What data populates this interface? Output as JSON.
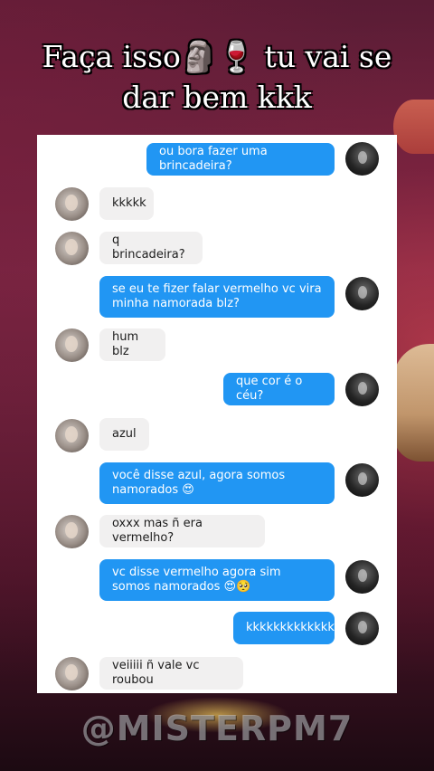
{
  "caption": {
    "line1": "Faça isso🗿🍷 tu vai se",
    "line2": "dar bem kkk"
  },
  "messages": [
    {
      "sender": "out",
      "text": "ou bora fazer uma brincadeira?"
    },
    {
      "sender": "in",
      "text": "kkkkk"
    },
    {
      "sender": "in",
      "text": "q brincadeira?"
    },
    {
      "sender": "out",
      "text": "se eu te fizer falar vermelho vc vira minha namorada blz?"
    },
    {
      "sender": "in",
      "text": "hum blz"
    },
    {
      "sender": "out",
      "text": "que cor é o céu?"
    },
    {
      "sender": "in",
      "text": "azul"
    },
    {
      "sender": "out",
      "text": "você disse azul, agora somos namorados 😍"
    },
    {
      "sender": "in",
      "text": "oxxx mas ñ era vermelho?"
    },
    {
      "sender": "out",
      "text": "vc disse vermelho agora sim somos namorados 😍🥺"
    },
    {
      "sender": "out",
      "text": "kkkkkkkkkkkkk"
    },
    {
      "sender": "in",
      "text": "veiiiii ñ vale vc roubou"
    }
  ],
  "watermark": "@MISTERPM7",
  "colors": {
    "outgoing_bubble": "#2196f3",
    "incoming_bubble": "#f1f0f0"
  }
}
